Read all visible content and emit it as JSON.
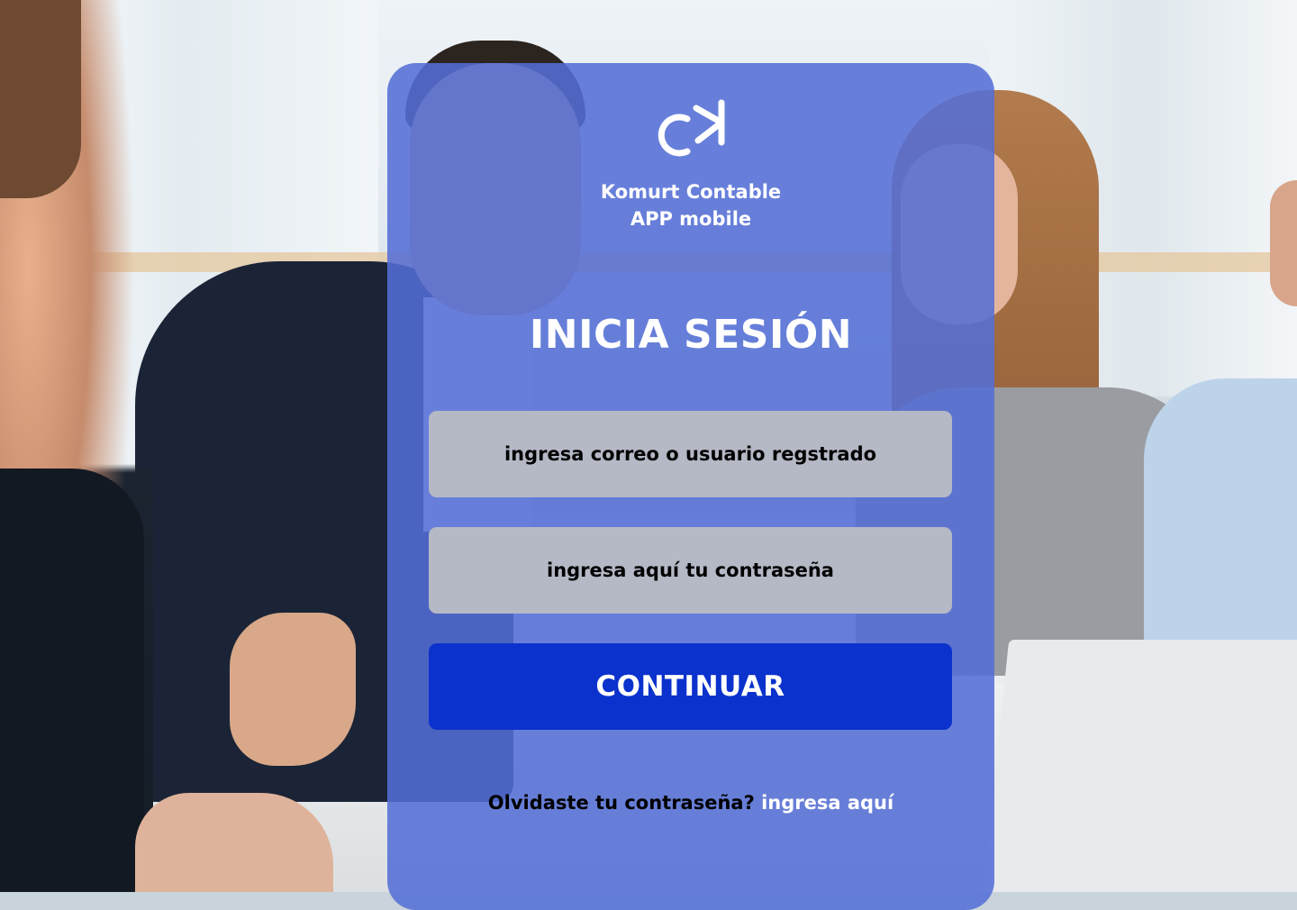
{
  "brand": {
    "logo_icon": "kc-monogram-icon",
    "name_line1": "Komurt Contable",
    "name_line2": "APP mobile"
  },
  "login": {
    "title": "INICIA SESIÓN",
    "username_placeholder": "ingresa correo o usuario regstrado",
    "password_placeholder": "ingresa aquí tu contraseña",
    "submit_label": "CONTINUAR",
    "forgot_text": "Olvidaste tu contraseña?",
    "forgot_link": "ingresa aquí"
  },
  "colors": {
    "card_overlay": "#546ed6",
    "input_bg": "#b5b9c6",
    "button_bg": "#0b32cc",
    "text_light": "#ffffff",
    "text_dark": "#000000"
  }
}
